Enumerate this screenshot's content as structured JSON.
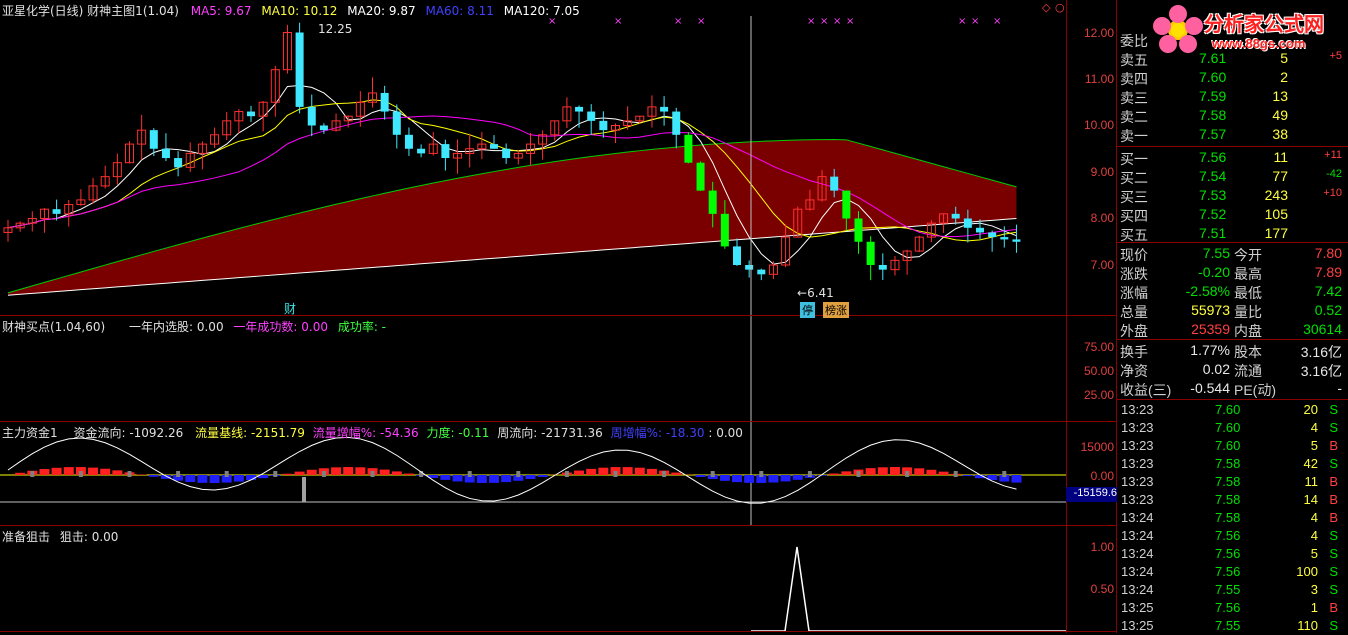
{
  "colors": {
    "up": "#ff3030",
    "down": "#40e8ff",
    "green_candle": "#00ff00",
    "ma5": "#ffffff",
    "ma10": "#ffff00",
    "ma20": "#ff00ff",
    "ma60": "#00cc00",
    "band": "#7a0000",
    "grid": "#8b0000"
  },
  "main_panel": {
    "title": "亚星化学(日线) 财神主图1(1.04)",
    "ma5_label": "MA5: 9.67",
    "ma10_label": "MA10: 10.12",
    "ma20_label": "MA20: 9.87",
    "ma60_label": "MA60: 8.11",
    "ma120_label": "MA120: 7.05",
    "high_marker": "12.25",
    "low_marker": "6.41",
    "badge_cai": "财",
    "badge_ting": "停",
    "badge_bang": "榜涨",
    "y_ticks": [
      "12.00",
      "11.00",
      "10.00",
      "9.00",
      "8.00",
      "7.00"
    ]
  },
  "panel2": {
    "title": "财神买点(1.04,60)",
    "select_label": "一年内选股: 0.00",
    "success_count_label": "一年成功数: 0.00",
    "success_rate_label": "成功率: -",
    "y_ticks": [
      "75.00",
      "50.00",
      "25.00"
    ]
  },
  "panel3": {
    "title": "主力资金1",
    "flow_label": "资金流向: -1092.26",
    "baseline_label": "流量基线: -2151.79",
    "amp_label": "流量增幅%: -54.36",
    "force_label": "力度: -0.11",
    "week_label": "周流向: -21731.36",
    "week_amp_label": "周增幅%: -18.30",
    "extra_label": ": 0.00",
    "y_ticks": [
      "15000",
      "0.00"
    ],
    "current_value": "-15159.6"
  },
  "panel4": {
    "title": "准备狙击",
    "value_label": "狙击: 0.00",
    "y_ticks": [
      "1.00",
      "0.50"
    ]
  },
  "logo": {
    "name": "分析家公式网",
    "url": "www.88gs.com"
  },
  "order_book": {
    "header": "委比",
    "asks": [
      {
        "label": "卖五",
        "price": "7.61",
        "vol": "5",
        "chg": "+5"
      },
      {
        "label": "卖四",
        "price": "7.60",
        "vol": "2",
        "chg": ""
      },
      {
        "label": "卖三",
        "price": "7.59",
        "vol": "13",
        "chg": ""
      },
      {
        "label": "卖二",
        "price": "7.58",
        "vol": "49",
        "chg": ""
      },
      {
        "label": "卖一",
        "price": "7.57",
        "vol": "38",
        "chg": ""
      }
    ],
    "bids": [
      {
        "label": "买一",
        "price": "7.56",
        "vol": "11",
        "chg": "+11"
      },
      {
        "label": "买二",
        "price": "7.54",
        "vol": "77",
        "chg": "-42"
      },
      {
        "label": "买三",
        "price": "7.53",
        "vol": "243",
        "chg": "+10"
      },
      {
        "label": "买四",
        "price": "7.52",
        "vol": "105",
        "chg": ""
      },
      {
        "label": "买五",
        "price": "7.51",
        "vol": "177",
        "chg": ""
      }
    ]
  },
  "quote": {
    "rows": [
      {
        "l1": "现价",
        "v1": "7.55",
        "l2": "今开",
        "v2": "7.80"
      },
      {
        "l1": "涨跌",
        "v1": "-0.20",
        "l2": "最高",
        "v2": "7.89"
      },
      {
        "l1": "涨幅",
        "v1": "-2.58%",
        "l2": "最低",
        "v2": "7.42"
      },
      {
        "l1": "总量",
        "v1": "55973",
        "l2": "量比",
        "v2": "0.52"
      },
      {
        "l1": "外盘",
        "v1": "25359",
        "l2": "内盘",
        "v2": "30614"
      }
    ],
    "rows2": [
      {
        "l1": "换手",
        "v1": "1.77%",
        "l2": "股本",
        "v2": "3.16亿"
      },
      {
        "l1": "净资",
        "v1": "0.02",
        "l2": "流通",
        "v2": "3.16亿"
      },
      {
        "l1": "收益(三)",
        "v1": "-0.544",
        "l2": "PE(动)",
        "v2": "-"
      }
    ]
  },
  "ticks": [
    {
      "time": "13:23",
      "price": "7.60",
      "vol": "20",
      "side": "S"
    },
    {
      "time": "13:23",
      "price": "7.60",
      "vol": "4",
      "side": "S"
    },
    {
      "time": "13:23",
      "price": "7.60",
      "vol": "5",
      "side": "B"
    },
    {
      "time": "13:23",
      "price": "7.58",
      "vol": "42",
      "side": "S"
    },
    {
      "time": "13:23",
      "price": "7.58",
      "vol": "11",
      "side": "B"
    },
    {
      "time": "13:23",
      "price": "7.58",
      "vol": "14",
      "side": "B"
    },
    {
      "time": "13:24",
      "price": "7.58",
      "vol": "4",
      "side": "B"
    },
    {
      "time": "13:24",
      "price": "7.56",
      "vol": "4",
      "side": "S"
    },
    {
      "time": "13:24",
      "price": "7.56",
      "vol": "5",
      "side": "S"
    },
    {
      "time": "13:24",
      "price": "7.56",
      "vol": "100",
      "side": "S"
    },
    {
      "time": "13:24",
      "price": "7.55",
      "vol": "3",
      "side": "S"
    },
    {
      "time": "13:25",
      "price": "7.56",
      "vol": "1",
      "side": "B"
    },
    {
      "time": "13:25",
      "price": "7.55",
      "vol": "110",
      "side": "S"
    }
  ]
}
